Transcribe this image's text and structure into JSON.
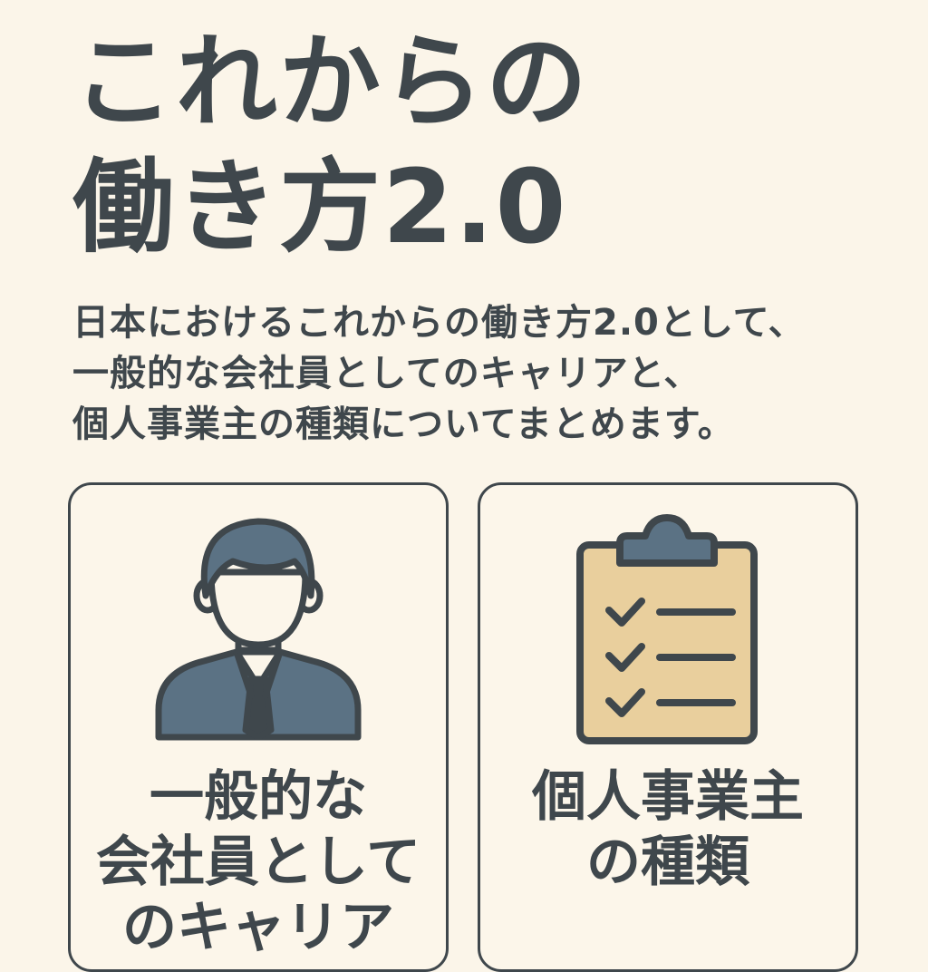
{
  "title": {
    "line1": "これからの",
    "line2": "働き方2.0"
  },
  "lead": {
    "line1": "日本におけるこれからの働き方2.0として、",
    "line2": "一般的な会社員としてのキャリアと、",
    "line3": "個人事業主の種類についてまとめます。"
  },
  "cards": [
    {
      "icon": "businessman-icon",
      "label_lines": [
        "一般的な",
        "会社員として",
        "のキャリア"
      ]
    },
    {
      "icon": "clipboard-checklist-icon",
      "label_lines": [
        "個人事業主",
        "の種類"
      ]
    }
  ],
  "colors": {
    "background": "#fbf5e9",
    "text": "#3f474c",
    "icon_fill": "#5b7284",
    "clipboard_paper": "#e9cf9d"
  }
}
